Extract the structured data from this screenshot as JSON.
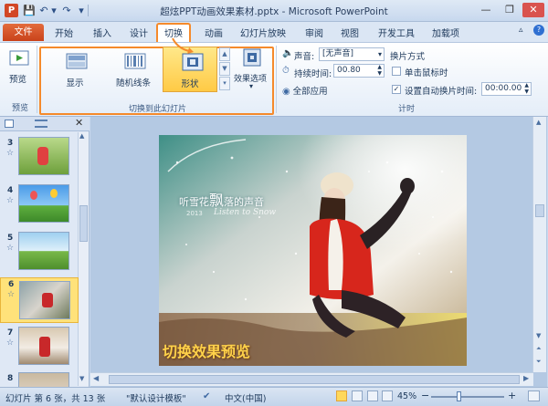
{
  "window": {
    "title": "超炫PPT动画效果素材.pptx - Microsoft PowerPoint",
    "app_icon_letter": "P",
    "controls": {
      "minimize": "—",
      "restore": "❐",
      "close": "✕"
    }
  },
  "quick_access": {
    "save": "💾",
    "undo": "↶",
    "undo_dd": "▾",
    "redo": "↷",
    "customize": "▾"
  },
  "tabs": [
    {
      "label": "文件"
    },
    {
      "label": "开始"
    },
    {
      "label": "插入"
    },
    {
      "label": "设计"
    },
    {
      "label": "切换"
    },
    {
      "label": "动画"
    },
    {
      "label": "幻灯片放映"
    },
    {
      "label": "审阅"
    },
    {
      "label": "视图"
    },
    {
      "label": "开发工具"
    },
    {
      "label": "加载项"
    }
  ],
  "ribbon_right_icons": {
    "minimize_ribbon": "▵",
    "help": "?"
  },
  "ribbon": {
    "preview": {
      "button_label": "预览",
      "group_label": "预览"
    },
    "transition_group": {
      "label": "切换到此幻灯片",
      "items": [
        {
          "label": "显示",
          "icon": "reveal-icon",
          "selected": false
        },
        {
          "label": "随机线条",
          "icon": "random-bars-icon",
          "selected": false
        },
        {
          "label": "形状",
          "icon": "shape-icon",
          "selected": true
        }
      ],
      "effect_options_label": "效果选项",
      "effect_options_arrow": "▾"
    },
    "timing": {
      "label": "计时",
      "sound_label": "声音:",
      "sound_value": "[无声音]",
      "duration_label": "持续时间:",
      "duration_value": "00.80",
      "apply_all_label": "全部应用",
      "advance_label": "换片方式",
      "on_click_label": "单击鼠标时",
      "on_click_checked": false,
      "after_label": "设置自动换片时间:",
      "after_checked": true,
      "after_value": "00:00.00"
    }
  },
  "slides_pane": {
    "thumbnails": [
      {
        "num": "3",
        "star": "☆",
        "selected": false
      },
      {
        "num": "4",
        "star": "☆",
        "selected": false
      },
      {
        "num": "5",
        "star": "☆",
        "selected": false
      },
      {
        "num": "6",
        "star": "☆",
        "selected": true
      },
      {
        "num": "7",
        "star": "☆",
        "selected": false
      },
      {
        "num": "8",
        "star": "☆",
        "selected": false
      }
    ]
  },
  "slide": {
    "poem_title_part1": "听雪花",
    "poem_title_big": "飘",
    "poem_title_part2": "落的声音",
    "poem_small": "2013",
    "poem_script": "Listen to Snow",
    "caption": "切换效果预览"
  },
  "statusbar": {
    "slide_info": "幻灯片 第 6 张，共 13 张",
    "theme": "\"默认设计模板\"",
    "language": "中文(中国)",
    "zoom": "45%",
    "zoom_minus": "−",
    "zoom_plus": "+"
  },
  "colors": {
    "accent_orange": "#f58a2b",
    "file_tab": "#d24726",
    "caption_text": "#ffd24a"
  }
}
